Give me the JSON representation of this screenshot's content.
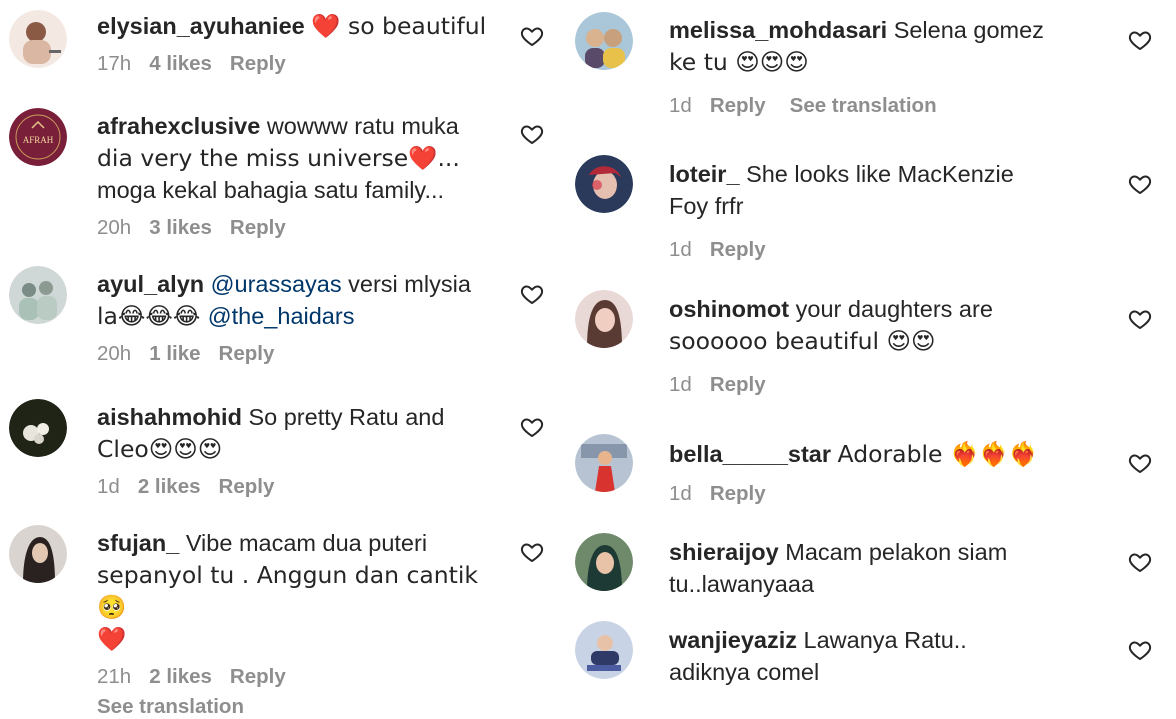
{
  "left_comments": [
    {
      "username": "elysian_ayuhaniee",
      "lines": [
        "❤️ so beautiful"
      ],
      "time": "17h",
      "likes": "4 likes",
      "reply": "Reply"
    },
    {
      "username": "afrahexclusive",
      "lines": [
        "wowww ratu muka",
        "dia very the miss universe❤️...",
        "moga kekal bahagia satu family..."
      ],
      "time": "20h",
      "likes": "3 likes",
      "reply": "Reply"
    },
    {
      "username": "ayul_alyn",
      "mention1": "@urassayas",
      "text1": " versi mlysia",
      "line2_text": "la😂😂😂 ",
      "mention2": "@the_haidars",
      "time": "20h",
      "likes": "1 like",
      "reply": "Reply"
    },
    {
      "username": "aishahmohid",
      "lines": [
        "So pretty Ratu and",
        "Cleo😍😍😍"
      ],
      "time": "1d",
      "likes": "2 likes",
      "reply": "Reply"
    },
    {
      "username": "sfujan_",
      "lines": [
        "Vibe macam dua puteri",
        "sepanyol tu . Anggun dan cantik 🥺",
        "❤️"
      ],
      "time": "21h",
      "likes": "2 likes",
      "reply": "Reply",
      "translation": "See translation"
    }
  ],
  "right_comments": [
    {
      "username": "melissa_mohdasari",
      "lines": [
        "Selena gomez",
        "ke tu 😍😍😍"
      ],
      "time": "1d",
      "reply": "Reply",
      "translation": "See translation"
    },
    {
      "username": "loteir_",
      "lines": [
        "She looks like MacKenzie",
        "Foy frfr"
      ],
      "time": "1d",
      "reply": "Reply"
    },
    {
      "username": "oshinomot",
      "lines": [
        "your daughters are",
        "soooooo beautiful 😍😍"
      ],
      "time": "1d",
      "reply": "Reply"
    },
    {
      "username": "bella_____star",
      "lines": [
        "Adorable ❤️‍🔥❤️‍🔥❤️‍🔥"
      ],
      "time": "1d",
      "reply": "Reply"
    },
    {
      "username": "shieraijoy",
      "lines": [
        "Macam pelakon siam",
        "tu..lawanyaaa"
      ]
    },
    {
      "username": "wanjieyaziz",
      "lines": [
        "Lawanya Ratu..",
        "adiknya comel"
      ]
    }
  ],
  "avatar_logo_text": "AFRAH",
  "icons": {
    "like": "heart-outline-icon"
  },
  "colors": {
    "meta": "#8e8e8e",
    "mention": "#00376b",
    "text": "#262626"
  }
}
